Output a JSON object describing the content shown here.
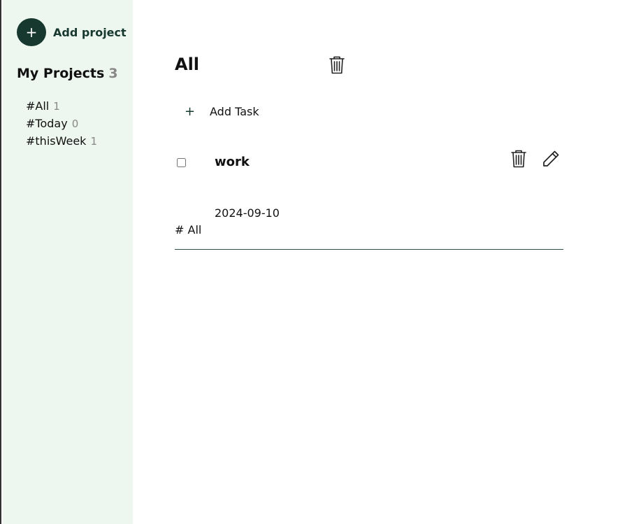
{
  "sidebar": {
    "add_project_icon": "+",
    "add_project_label": "Add project",
    "projects_heading": "My Projects",
    "projects_count": "3",
    "projects": [
      {
        "label": "#All",
        "count": "1"
      },
      {
        "label": "#Today",
        "count": "0"
      },
      {
        "label": "#thisWeek",
        "count": "1"
      }
    ]
  },
  "main": {
    "title": "All",
    "add_task_icon": "+",
    "add_task_label": "Add Task",
    "tasks": [
      {
        "title": "work",
        "date": "2024-09-10",
        "project": "# All",
        "done": false
      }
    ]
  },
  "icons": {
    "delete_project": "trash-icon",
    "task_delete": "trash-icon",
    "task_edit": "pencil-icon"
  },
  "colors": {
    "sidebar_bg": "#edf6ef",
    "accent": "#17382f",
    "muted_count": "#888888"
  }
}
